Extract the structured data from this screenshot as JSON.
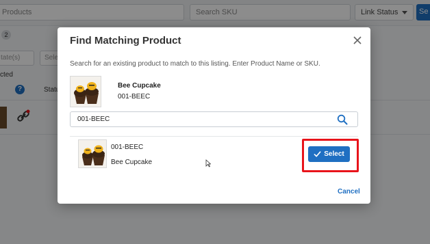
{
  "background": {
    "products_input": "Products",
    "search_sku_placeholder": "Search SKU",
    "link_status_label": "Link Status",
    "search_button_label": "Se",
    "badge_count": "2",
    "state_select": "tate(s)",
    "select_partial": "Sele",
    "selected_text": "cted",
    "status_col": "Status",
    "help_symbol": "?"
  },
  "modal": {
    "title": "Find Matching Product",
    "instructions": "Search for an existing product to match to this listing. Enter Product Name or SKU.",
    "product": {
      "name": "Bee Cupcake",
      "sku": "001-BEEC"
    },
    "search": {
      "value": "001-BEEC"
    },
    "results": [
      {
        "sku": "001-BEEC",
        "name": "Bee Cupcake",
        "action": "Select"
      }
    ],
    "cancel_label": "Cancel"
  },
  "colors": {
    "accent": "#1f6fc2",
    "highlight": "#e8141b"
  }
}
